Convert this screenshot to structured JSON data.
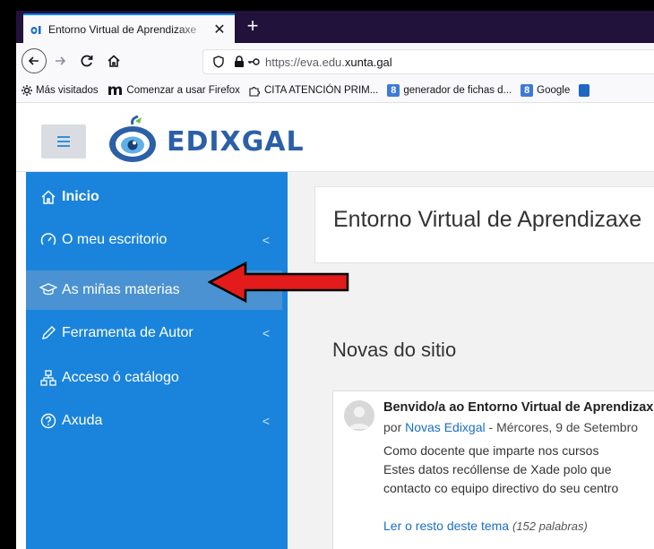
{
  "browser": {
    "tab_title": "Entorno Virtual de Aprendizaxe",
    "tab_close": "✕",
    "new_tab": "+",
    "url_prefix": "https://eva.edu.",
    "url_domain": "xunta.gal",
    "bookmarks": [
      {
        "label": "Más visitados",
        "icon": "gear-icon"
      },
      {
        "label": "Comenzar a usar Firefox",
        "icon": "m-logo-icon"
      },
      {
        "label": "CITA ATENCIÓN PRIM...",
        "icon": "puzzle-icon"
      },
      {
        "label": "generador de fichas d...",
        "icon": "blue-8-icon"
      },
      {
        "label": "Google",
        "icon": "blue-8-icon"
      }
    ]
  },
  "site": {
    "brand": "EDIXGAL",
    "colors": {
      "sidebar": "#1a84dc",
      "active": "#4a92d2",
      "brand": "#2b5fa8"
    }
  },
  "sidebar": {
    "items": [
      {
        "label": "Inicio",
        "icon": "home-icon"
      },
      {
        "label": "O meu escritorio",
        "icon": "dashboard-icon"
      },
      {
        "label": "As miñas materias",
        "icon": "graduation-cap-icon"
      },
      {
        "label": "Ferramenta de Autor",
        "icon": "pencil-icon"
      },
      {
        "label": "Acceso ó catálogo",
        "icon": "sitemap-icon"
      },
      {
        "label": "Axuda",
        "icon": "question-circle-icon"
      }
    ]
  },
  "main": {
    "page_title": "Entorno Virtual de Aprendizaxe",
    "news_heading": "Novas do sitio",
    "post": {
      "title": "Benvido/a ao Entorno Virtual de Aprendizaxe",
      "by": "por",
      "author": "Novas Edixgal",
      "date": " - Mércores, 9 de Setembro",
      "line1": "Como docente que imparte nos cursos",
      "line2": "Estes datos recóllense de Xade polo que",
      "line3": "contacto co equipo directivo do seu centro",
      "read_more": "Ler o resto deste tema",
      "word_count": "(152 palabras)"
    }
  }
}
